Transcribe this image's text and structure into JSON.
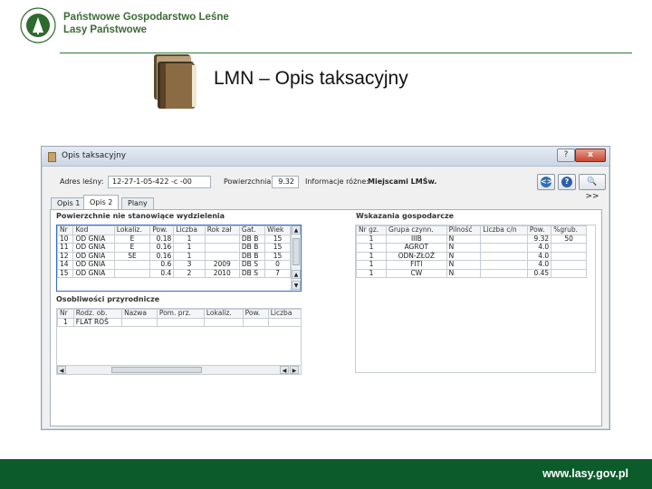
{
  "header": {
    "org_name_line1": "Państwowe Gospodarstwo Leśne",
    "org_name_line2": "Lasy Państwowe",
    "slide_title": "LMN – Opis taksacyjny",
    "logo_icon": "lasy-panstwowe-logo-icon",
    "books_icon": "books-icon"
  },
  "footer": {
    "url": "www.lasy.gov.pl",
    "bar_color": "#0c5b2a"
  },
  "window": {
    "title": "Opis taksacyjny",
    "help_label": "?",
    "close_label": "x",
    "adres_label": "Adres leśny:",
    "adres_value": "12-27-1-05-422   -c   -00",
    "powierzchnia_label": "Powierzchnia:",
    "powierzchnia_value": "9.32",
    "informacje_label": "Informacje różne:",
    "informacje_value": "Miejscami LMŚw.",
    "btn_nav_label": "<>",
    "btn_help_label": "?",
    "btn_more_label": "🔍 >>",
    "tabs": [
      "Opis 1",
      "Opis 2",
      "Plany"
    ],
    "active_tab": "Opis 2"
  },
  "powierzchnie": {
    "title": "Powierzchnie nie stanowiące wydzielenia",
    "columns": [
      "Nr",
      "Kod",
      "Lokaliz.",
      "Pow.",
      "Liczba",
      "Rok zał",
      "Gat.",
      "Wiek"
    ],
    "rows": [
      [
        "10",
        "OD GNIA",
        "E",
        "0.18",
        "1",
        "",
        "DB B",
        "15"
      ],
      [
        "11",
        "OD GNIA",
        "E",
        "0.16",
        "1",
        "",
        "DB B",
        "15"
      ],
      [
        "12",
        "OD GNIA",
        "SE",
        "0.16",
        "1",
        "",
        "DB B",
        "15"
      ],
      [
        "14",
        "OD GNIA",
        "",
        "0.6",
        "3",
        "2009",
        "DB S",
        "0"
      ],
      [
        "15",
        "OD GNIA",
        "",
        "0.4",
        "2",
        "2010",
        "DB S",
        "7"
      ]
    ]
  },
  "osobliwosci": {
    "title": "Osobliwości przyrodnicze",
    "columns": [
      "Nr",
      "Rodz. ob.",
      "Nazwa",
      "Pom. prz.",
      "Lokaliz.",
      "Pow.",
      "Liczba"
    ],
    "rows": [
      [
        "1",
        "FLAT ROŚ",
        "",
        "",
        "",
        "",
        ""
      ]
    ]
  },
  "wskazania": {
    "title": "Wskazania gospodarcze",
    "columns": [
      "Nr gz.",
      "Grupa czynn.",
      "Pilność",
      "Liczba c/n",
      "Pow.",
      "%grub."
    ],
    "rows": [
      [
        "1",
        "IIIB",
        "N",
        "",
        "9.32",
        "50"
      ],
      [
        "1",
        "AGROT",
        "N",
        "",
        "4.0",
        ""
      ],
      [
        "1",
        "ODN-ZŁOŻ",
        "N",
        "",
        "4.0",
        ""
      ],
      [
        "1",
        "FITI",
        "N",
        "",
        "4.0",
        ""
      ],
      [
        "1",
        "CW",
        "N",
        "",
        "0.45",
        ""
      ]
    ]
  }
}
